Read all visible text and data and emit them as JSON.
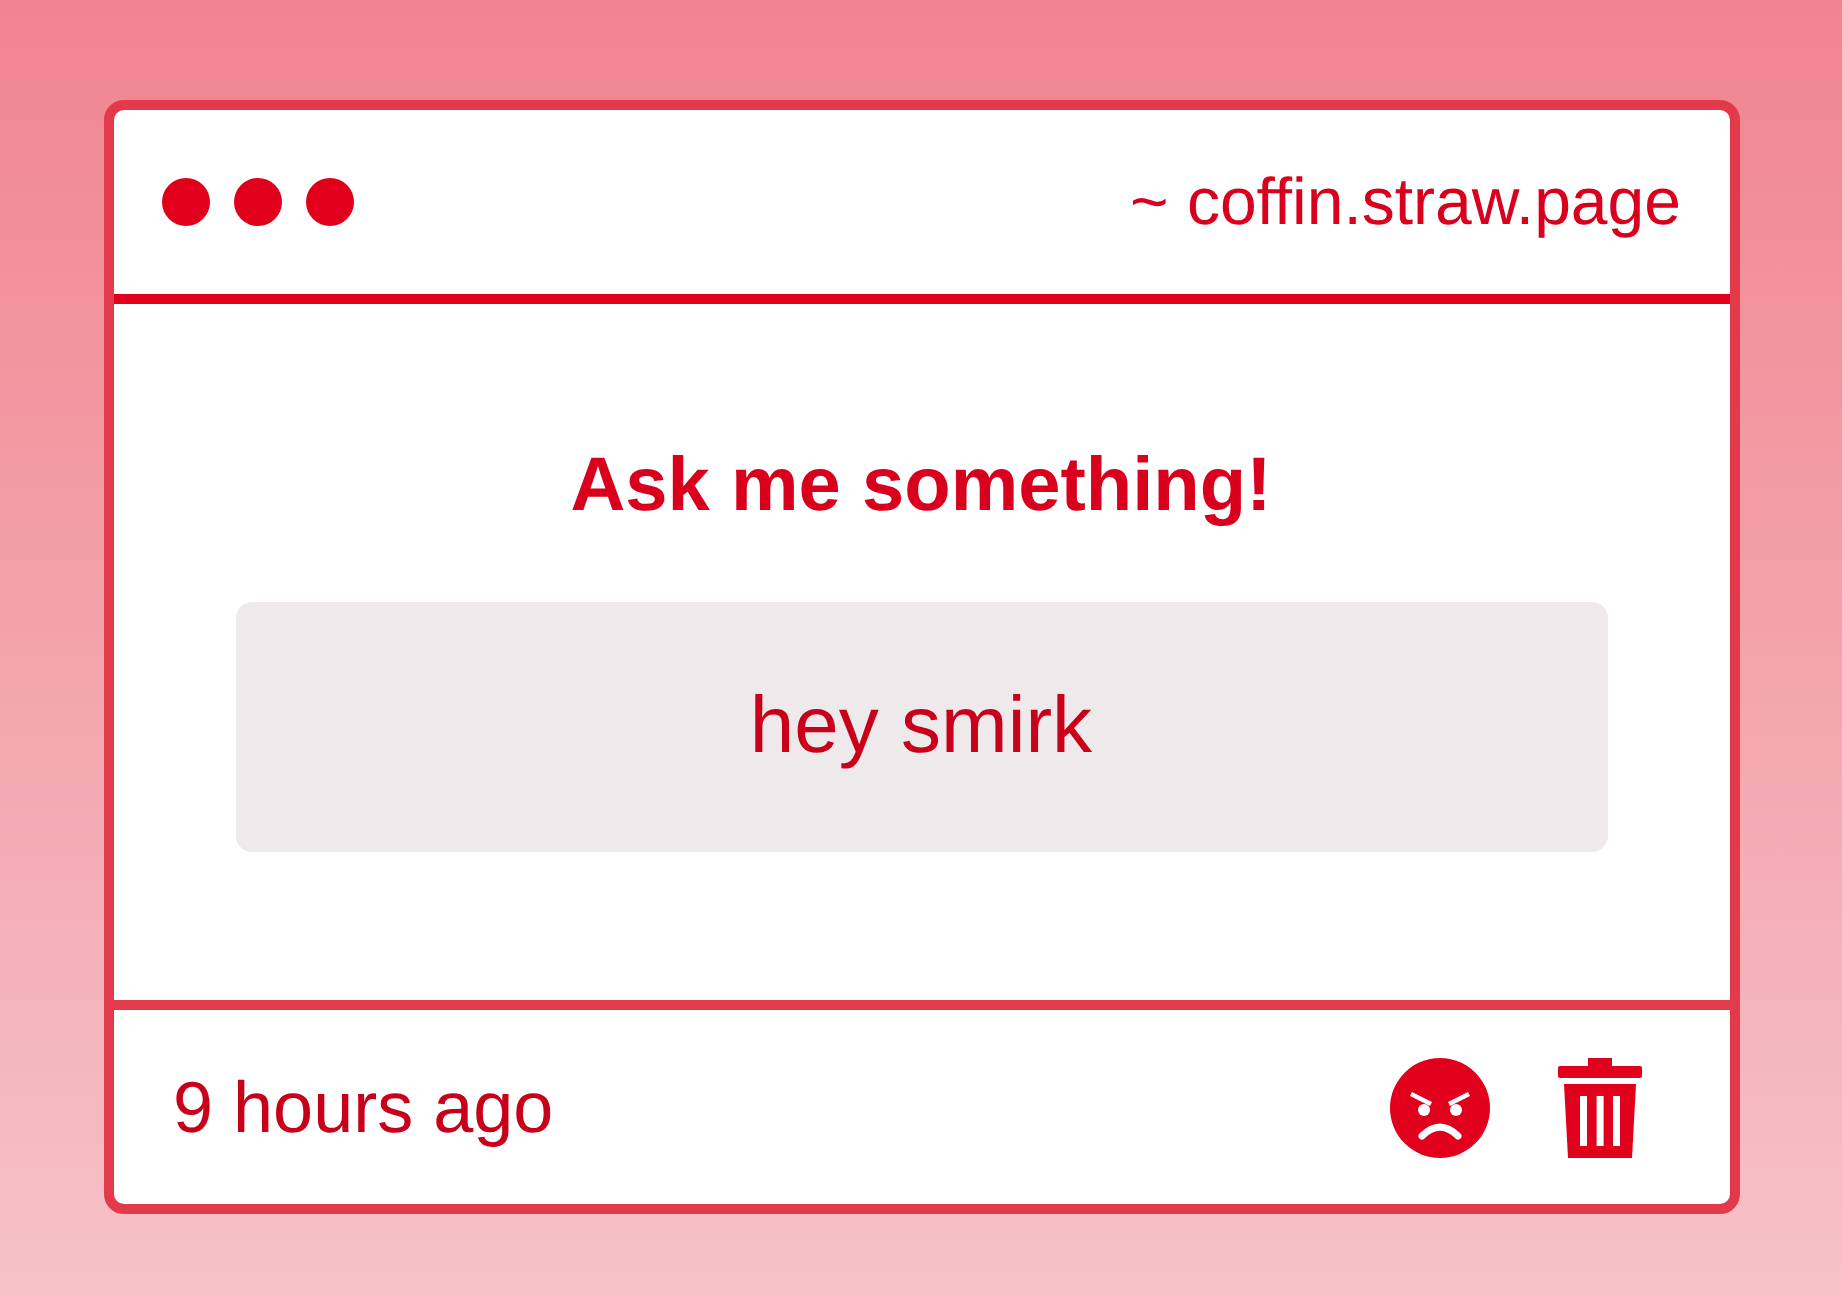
{
  "window": {
    "address": "~ coffin.straw.page"
  },
  "card": {
    "title": "Ask me something!",
    "message": "hey smirk"
  },
  "footer": {
    "time": "9 hours ago"
  }
}
